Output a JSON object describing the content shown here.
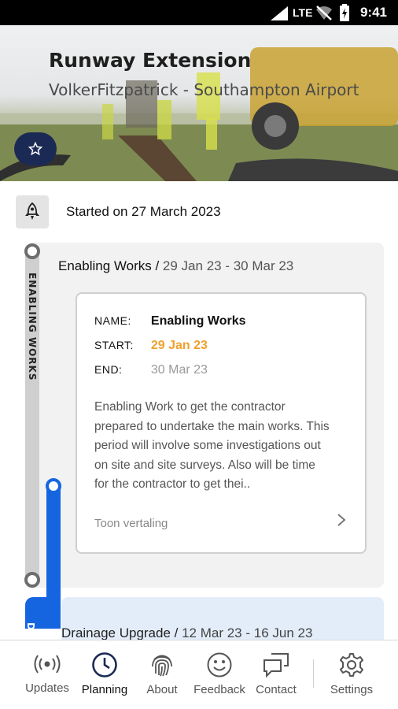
{
  "status_bar": {
    "network": "LTE",
    "time": "9:41"
  },
  "project": {
    "title": "Runway Extension",
    "subtitle": "VolkerFitzpatrick - Southampton Airport"
  },
  "started": {
    "text": "Started on 27 March 2023"
  },
  "phases": [
    {
      "side_label": "ENABLING WORKS",
      "name": "Enabling Works /",
      "dates": " 29 Jan 23 - 30 Mar 23",
      "detail": {
        "name_key": "NAME:",
        "name_value": "Enabling Works",
        "start_key": "START:",
        "start_value": "29 Jan 23",
        "end_key": "END:",
        "end_value": "30 Mar 23",
        "description": "Enabling Work to get the contractor prepared to undertake the main works. This period will involve some investigations out on site and site surveys. Also will be time for the contractor to get thei..",
        "translate_link": "Toon vertaling"
      }
    },
    {
      "side_label": "DR",
      "name": "Drainage Upgrade /",
      "dates": " 12 Mar 23 - 16 Jun 23"
    }
  ],
  "colors": {
    "accent_blue": "#1565e0",
    "start_orange": "#f0a030",
    "nav_dark": "#1b2a55"
  },
  "nav": {
    "items": [
      {
        "label": "Updates",
        "icon": "broadcast-icon"
      },
      {
        "label": "Planning",
        "icon": "clock-icon",
        "active": true
      },
      {
        "label": "About",
        "icon": "fingerprint-icon"
      },
      {
        "label": "Feedback",
        "icon": "smiley-icon"
      },
      {
        "label": "Contact",
        "icon": "chat-icon"
      },
      {
        "label": "Settings",
        "icon": "gear-icon"
      }
    ]
  }
}
